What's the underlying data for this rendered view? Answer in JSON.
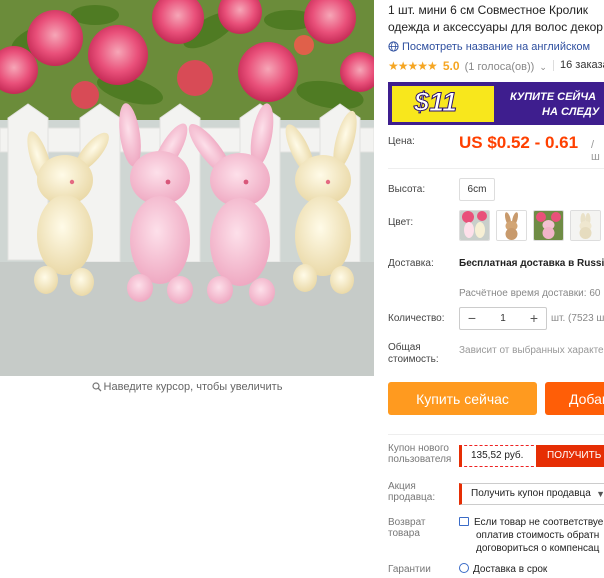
{
  "gallery": {
    "zoom_hint": "Наведите курсор, чтобы увеличить"
  },
  "product": {
    "title_line1": "1 шт. мини 6 см Совместное Кролик",
    "title_line2": "одежда и аксессуары для волос декор",
    "translate_link": "Посмотреть название на английском",
    "stars": "★★★★★",
    "rating": "5.0",
    "votes": "(1 голоса(ов))",
    "orders": "16 заказа"
  },
  "banner": {
    "amount": "$11",
    "line1": "КУПИТЕ СЕЙЧА",
    "line2": "НА СЛЕДУ"
  },
  "price": {
    "label": "Цена:",
    "value": "US $0.52 - 0.61",
    "unit": "/ ш"
  },
  "options": {
    "height_label": "Высота:",
    "height_value": "6cm",
    "color_label": "Цвет:"
  },
  "shipping": {
    "label": "Доставка:",
    "value": "Бесплатная доставка в Russi",
    "eta": "Расчётное время доставки: 60"
  },
  "quantity": {
    "label": "Количество:",
    "minus": "−",
    "value": "1",
    "plus": "+",
    "note": "шт. (7523 ш"
  },
  "total": {
    "label_line1": "Общая",
    "label_line2": "стоимость:",
    "value": "Зависит от выбранных характе"
  },
  "actions": {
    "buy_now": "Купить сейчас",
    "add_to_cart": "Добав"
  },
  "coupon": {
    "label_line1": "Купон нового",
    "label_line2": "пользователя",
    "amount": "135,52 руб.",
    "get": "ПОЛУЧИТЬ"
  },
  "promo": {
    "label_line1": "Акция",
    "label_line2": "продавца:",
    "select": "Получить купон продавца"
  },
  "returns": {
    "label_line1": "Возврат",
    "label_line2": "товара",
    "line1": "Если товар не соответствуе",
    "line2": "оплатив стоимость обратн",
    "line3": "договориться о компенсац"
  },
  "guarantee": {
    "label": "Гарантии",
    "value": "Доставка в срок"
  },
  "colors": {
    "accent_orange": "#ff9a1f",
    "cart_orange": "#ff5e07",
    "price_red": "#ff4000",
    "coupon_red": "#e62e04",
    "banner_purple": "#3e1e8e",
    "banner_yellow": "#f8e71c",
    "link_blue": "#2e4f9f",
    "star_gold": "#f5a623"
  }
}
